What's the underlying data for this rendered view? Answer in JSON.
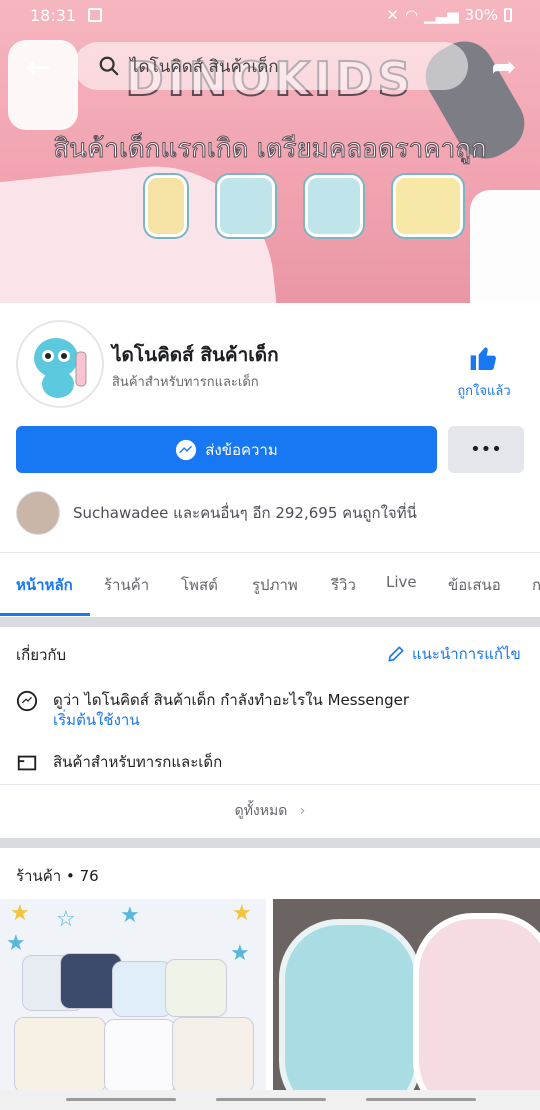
{
  "status": {
    "time": "18:31",
    "battery": "30%"
  },
  "search": {
    "placeholder": "ไดโนคิดส์ สินค้าเด็ก"
  },
  "cover": {
    "brand": "DINOKIDS",
    "tagline": "สินค้าเด็กแรกเกิด เตรียมคลอดราคาถูก"
  },
  "page": {
    "name": "ไดโนคิดส์ สินค้าเด็ก",
    "category": "สินค้าสำหรับทารกและเด็ก",
    "like_label": "ถูกใจแล้ว"
  },
  "actions": {
    "message_label": "ส่งข้อความ",
    "more_label": "•••"
  },
  "friends": {
    "text": "Suchawadee และคนอื่นๆ อีก 292,695 คนถูกใจที่นี่"
  },
  "tabs": [
    {
      "label": "หน้าหลัก",
      "active": true
    },
    {
      "label": "ร้านค้า"
    },
    {
      "label": "โพสต์"
    },
    {
      "label": "รูปภาพ"
    },
    {
      "label": "รีวิว"
    },
    {
      "label": "Live"
    },
    {
      "label": "ข้อเสนอ"
    },
    {
      "label": "ก"
    }
  ],
  "about": {
    "title": "เกี่ยวกับ",
    "suggest_edit": "แนะนำการแก้ไข",
    "messenger_text": "ดูว่า ไดโนคิดส์ สินค้าเด็ก กำลังทำอะไรใน Messenger",
    "messenger_link": "เริ่มต้นใช้งาน",
    "category_link": "สินค้าสำหรับทารกและเด็ก",
    "see_all": "ดูทั้งหมด"
  },
  "shop": {
    "title": "ร้านค้า • 76"
  },
  "colors": {
    "accent": "#1877f2",
    "separator": "#d9dbe0"
  }
}
